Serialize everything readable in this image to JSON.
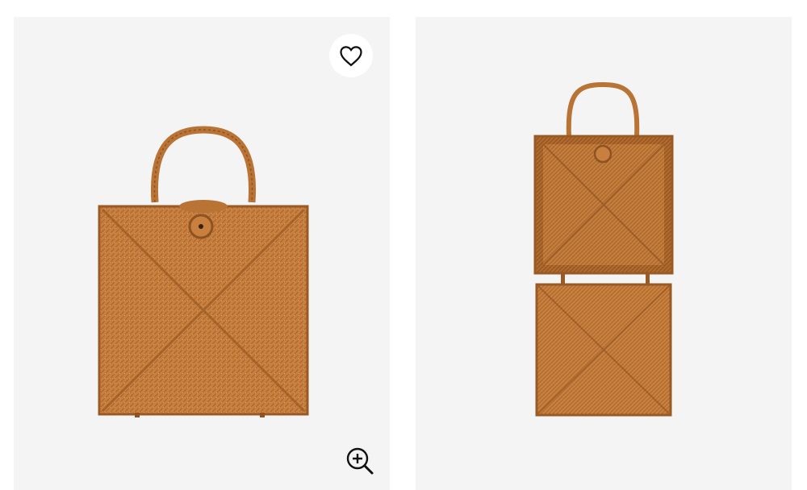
{
  "gallery": {
    "images": [
      {
        "id": "front",
        "subject": "rattan-square-handbag-front",
        "colors": {
          "weave": "#c9803f",
          "weave_dark": "#9a5a25",
          "handle": "#b97435"
        }
      },
      {
        "id": "open",
        "subject": "rattan-square-handbag-open",
        "colors": {
          "weave": "#c9803f",
          "weave_dark": "#9a5a25",
          "handle": "#b97435"
        }
      }
    ],
    "favorite": {
      "icon": "heart-outline-icon"
    },
    "zoom": {
      "icon": "zoom-in-icon"
    }
  },
  "theme": {
    "card_bg": "#f4f4f5",
    "button_bg": "#ffffff",
    "icon_color": "#111111"
  }
}
